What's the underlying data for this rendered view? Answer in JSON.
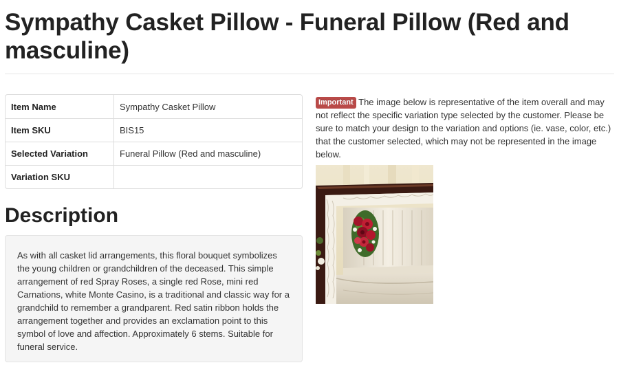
{
  "page": {
    "title": "Sympathy Casket Pillow - Funeral Pillow (Red and masculine)"
  },
  "item_table": {
    "rows": [
      {
        "key": "Item Name",
        "value": "Sympathy Casket Pillow"
      },
      {
        "key": "Item SKU",
        "value": "BIS15"
      },
      {
        "key": "Selected Variation",
        "value": "Funeral Pillow (Red and masculine)"
      },
      {
        "key": "Variation SKU",
        "value": ""
      }
    ]
  },
  "description": {
    "heading": "Description",
    "body": "As with all casket lid arrangements, this floral bouquet symbolizes the young children or grandchildren of the deceased. This simple arrangement of red Spray Roses, a single red Rose, mini red Carnations, white Monte Casino, is a traditional and classic way for a grandchild to remember a grandparent. Red satin ribbon holds the arrangement together and provides an exclamation point to this symbol of love and affection. Approximately 6 stems. Suitable for funeral service."
  },
  "notice": {
    "badge": "Important",
    "text": "The image below is representative of the item overall and may not reflect the specific variation type selected by the customer. Please be sure to match your design to the variation and options (ie. vase, color, etc.) that the customer selected, which may not be represented in the image below."
  },
  "colors": {
    "important_badge": "#b94a48",
    "well_background": "#f5f5f5",
    "table_border": "#dddddd"
  }
}
